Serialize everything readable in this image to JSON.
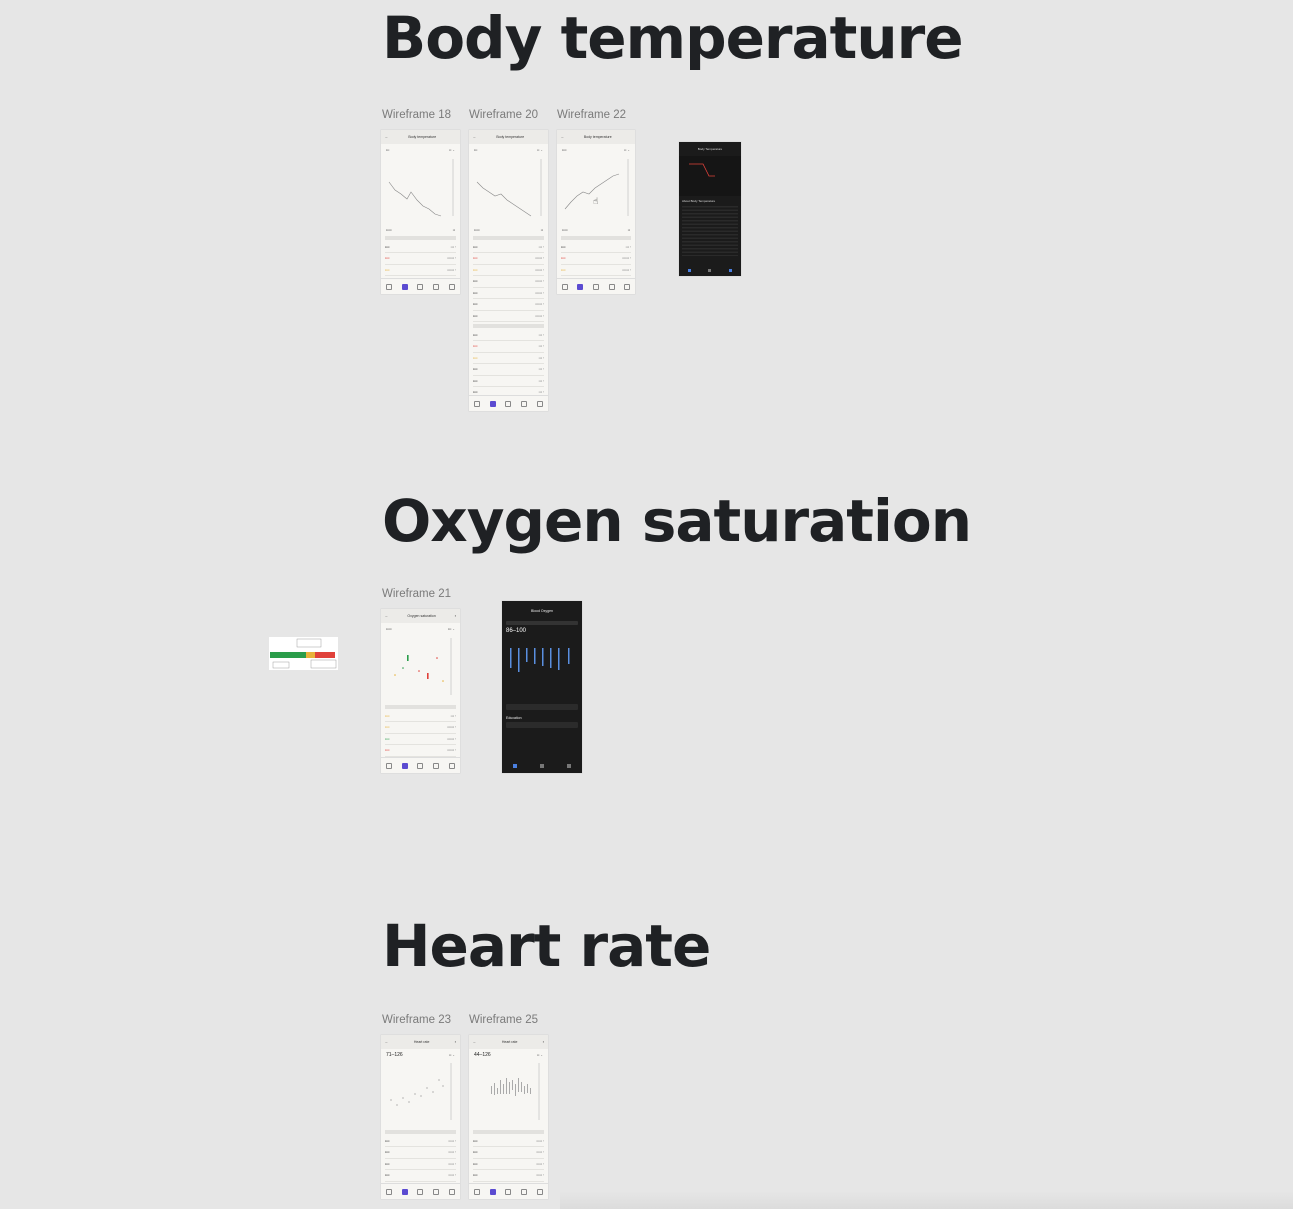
{
  "sections": {
    "body_temperature": {
      "title": "Body temperature",
      "frames": [
        {
          "label": "Wireframe 18",
          "header": "Body temperature"
        },
        {
          "label": "Wireframe 20",
          "header": "Body temperature"
        },
        {
          "label": "Wireframe 22",
          "header": "Body temperature"
        }
      ],
      "dark_frame_header": "Body Temperature",
      "dark_frame_section": "About Body Temperature"
    },
    "oxygen_saturation": {
      "title": "Oxygen saturation",
      "frames": [
        {
          "label": "Wireframe 21",
          "header": "Oxygen saturation"
        }
      ],
      "dark_frame_header": "Blood Oxygen",
      "dark_frame_range": "86–100",
      "dark_frame_section": "Education"
    },
    "heart_rate": {
      "title": "Heart rate",
      "frames": [
        {
          "label": "Wireframe 23",
          "header": "Heart rate",
          "range": "71–126"
        },
        {
          "label": "Wireframe 25",
          "header": "Heart rate",
          "range": "44–126"
        }
      ]
    }
  },
  "colors": {
    "background": "#e6e6e6",
    "frame": "#f7f6f3",
    "accent": "#5b4bd1",
    "warning": "#e0413a",
    "caution": "#e8b23a"
  }
}
